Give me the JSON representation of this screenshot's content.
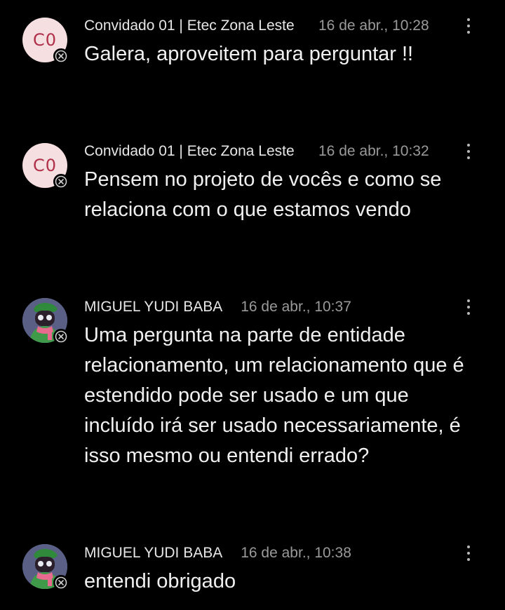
{
  "messages": [
    {
      "author": "Convidado 01 | Etec Zona Leste",
      "initials": "C0",
      "time": "16 de abr., 10:28",
      "text": "Galera, aproveitem para perguntar !!"
    },
    {
      "author": "Convidado 01 | Etec Zona Leste",
      "initials": "C0",
      "time": "16 de abr., 10:32",
      "text": "Pensem no projeto de vocês e como se relaciona com o que estamos vendo"
    },
    {
      "author": "MIGUEL YUDI BABA",
      "time": "16 de abr., 10:37",
      "text": "Uma pergunta na parte de entidade relacionamento, um relacionamento que é estendido pode ser usado e um que incluído irá ser usado necessariamente, é isso mesmo ou entendi errado?"
    },
    {
      "author": "MIGUEL YUDI BABA",
      "time": "16 de abr., 10:38",
      "text": "entendi obrigado"
    }
  ],
  "icons": {
    "status": "offline-status-icon",
    "more": "more-vertical-icon"
  },
  "colors": {
    "background": "#000000",
    "initials_avatar_bg": "#f6dfe0",
    "initials_avatar_fg": "#b0304a",
    "timestamp": "#9a9a9a"
  }
}
